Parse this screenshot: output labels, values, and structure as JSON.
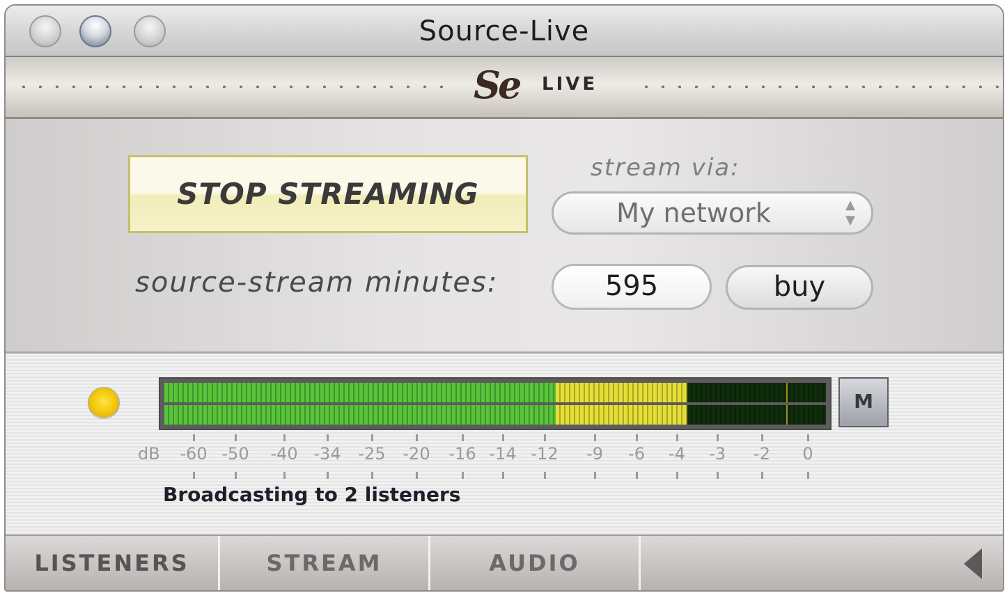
{
  "window": {
    "title": "Source-Live"
  },
  "logo": {
    "mark": "Se",
    "text": "LIVE"
  },
  "controls": {
    "stop_label": "STOP  STREAMING",
    "stream_via_label": "stream via:",
    "stream_via_value": "My network",
    "minutes_label": "source-stream minutes:",
    "minutes_value": "595",
    "buy_label": "buy"
  },
  "meter": {
    "level_fraction": 0.79,
    "peak_fraction": 0.94,
    "colors": {
      "green": "#58c43a",
      "yellow": "#e5de36",
      "off": "#0f2c0b",
      "led": "#f1c500"
    },
    "mute_label": "M",
    "scale_unit": "dB",
    "scale_ticks": [
      "-60",
      "-50",
      "-40",
      "-34",
      "-25",
      "-20",
      "-16",
      "-14",
      "-12",
      "-9",
      "-6",
      "-4",
      "-3",
      "-2",
      "0"
    ]
  },
  "status": {
    "text": "Broadcasting to 2 listeners"
  },
  "tabs": [
    {
      "label": "LISTENERS"
    },
    {
      "label": "STREAM"
    },
    {
      "label": "AUDIO"
    }
  ],
  "icons": {
    "led": "status-led-icon",
    "select_arrows": "updown-arrows-icon",
    "collapse": "triangle-left-icon"
  }
}
